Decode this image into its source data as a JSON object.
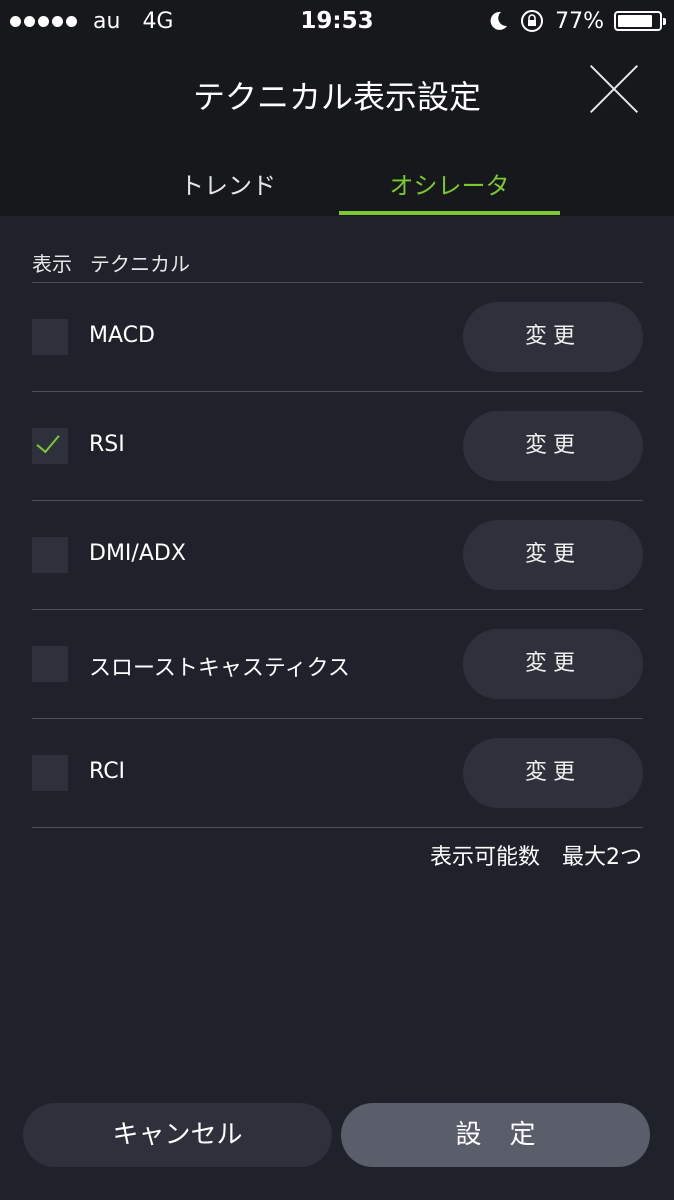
{
  "status_bar": {
    "carrier": "au",
    "network": "4G",
    "time": "19:53",
    "battery": "77%",
    "battery_level": 0.77
  },
  "header": {
    "title": "テクニカル表示設定",
    "tabs": [
      {
        "label": "トレンド",
        "active": false
      },
      {
        "label": "オシレータ",
        "active": true
      }
    ]
  },
  "colors": {
    "accent": "#7cc830",
    "background": "#1f222b",
    "header_bg": "#16181c",
    "button_bg": "#2e313b",
    "primary_button_bg": "#5a5e6a"
  },
  "list": {
    "col_display": "表示",
    "col_technical": "テクニカル",
    "items": [
      {
        "label": "MACD",
        "checked": false,
        "button": "変更"
      },
      {
        "label": "RSI",
        "checked": true,
        "button": "変更"
      },
      {
        "label": "DMI/ADX",
        "checked": false,
        "button": "変更"
      },
      {
        "label": "スローストキャスティクス",
        "checked": false,
        "button": "変更"
      },
      {
        "label": "RCI",
        "checked": false,
        "button": "変更"
      }
    ],
    "max_note": "表示可能数　最大2つ"
  },
  "footer": {
    "cancel_label": "キャンセル",
    "set_label": "設定"
  },
  "icons": {
    "close": "close-icon",
    "moon": "moon-icon",
    "rotation_lock": "rotation-lock-icon",
    "battery": "battery-icon",
    "check": "checkmark-icon"
  }
}
